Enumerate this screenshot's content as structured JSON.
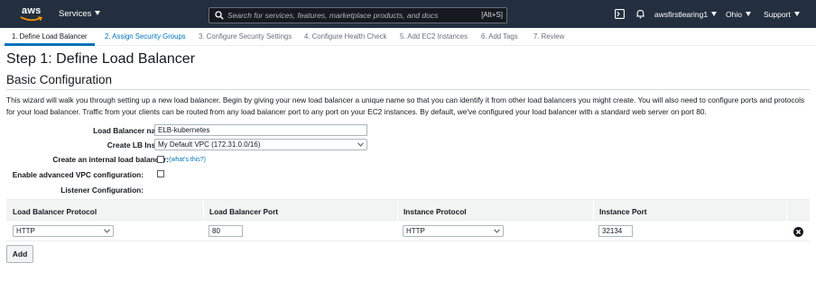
{
  "topnav": {
    "logo_text": "aws",
    "services_label": "Services",
    "search_placeholder": "Search for services, features, marketplace products, and docs",
    "search_shortcut": "[Alt+S]",
    "account_label": "awsfirstlearing1",
    "region_label": "Ohio",
    "support_label": "Support",
    "icons": [
      "terminal-icon",
      "bell-icon"
    ],
    "background_color": "#232f3e"
  },
  "wizard_tabs": [
    {
      "label": "1. Define Load Balancer",
      "state": "active"
    },
    {
      "label": "2. Assign Security Groups",
      "state": "next"
    },
    {
      "label": "3. Configure Security Settings",
      "state": "disabled"
    },
    {
      "label": "4. Configure Health Check",
      "state": "disabled"
    },
    {
      "label": "5. Add EC2 Instances",
      "state": "disabled"
    },
    {
      "label": "6. Add Tags",
      "state": "disabled"
    },
    {
      "label": "7. Review",
      "state": "disabled"
    }
  ],
  "page": {
    "step_title": "Step 1: Define Load Balancer",
    "section_title": "Basic Configuration",
    "description": "This wizard will walk you through setting up a new load balancer. Begin by giving your new load balancer a unique name so that you can identify it from other load balancers you might create. You will also need to configure ports and protocols for your load balancer. Traffic from your clients can be routed from any load balancer port to any port on your EC2 instances. By default, we've configured your load balancer with a standard web server on port 80."
  },
  "form": {
    "lb_name_label": "Load Balancer name:",
    "lb_name_value": "ELB-kubernetes",
    "create_inside_label": "Create LB Inside:",
    "create_inside_value": "My Default VPC (172.31.0.0/16)",
    "internal_label": "Create an internal load balancer:",
    "internal_checked": false,
    "whats_this": "(what's this?)",
    "advanced_vpc_label": "Enable advanced VPC configuration:",
    "advanced_vpc_checked": false,
    "listener_label": "Listener Configuration:"
  },
  "listener_table": {
    "headers": [
      "Load Balancer Protocol",
      "Load Balancer Port",
      "Instance Protocol",
      "Instance Port"
    ],
    "rows": [
      {
        "lb_protocol": "HTTP",
        "lb_port": "80",
        "instance_protocol": "HTTP",
        "instance_port": "32134"
      }
    ],
    "add_label": "Add"
  },
  "colors": {
    "link": "#0073bb",
    "active_tab_underline": "#0073bb",
    "header_bg": "#f2f3f3"
  }
}
